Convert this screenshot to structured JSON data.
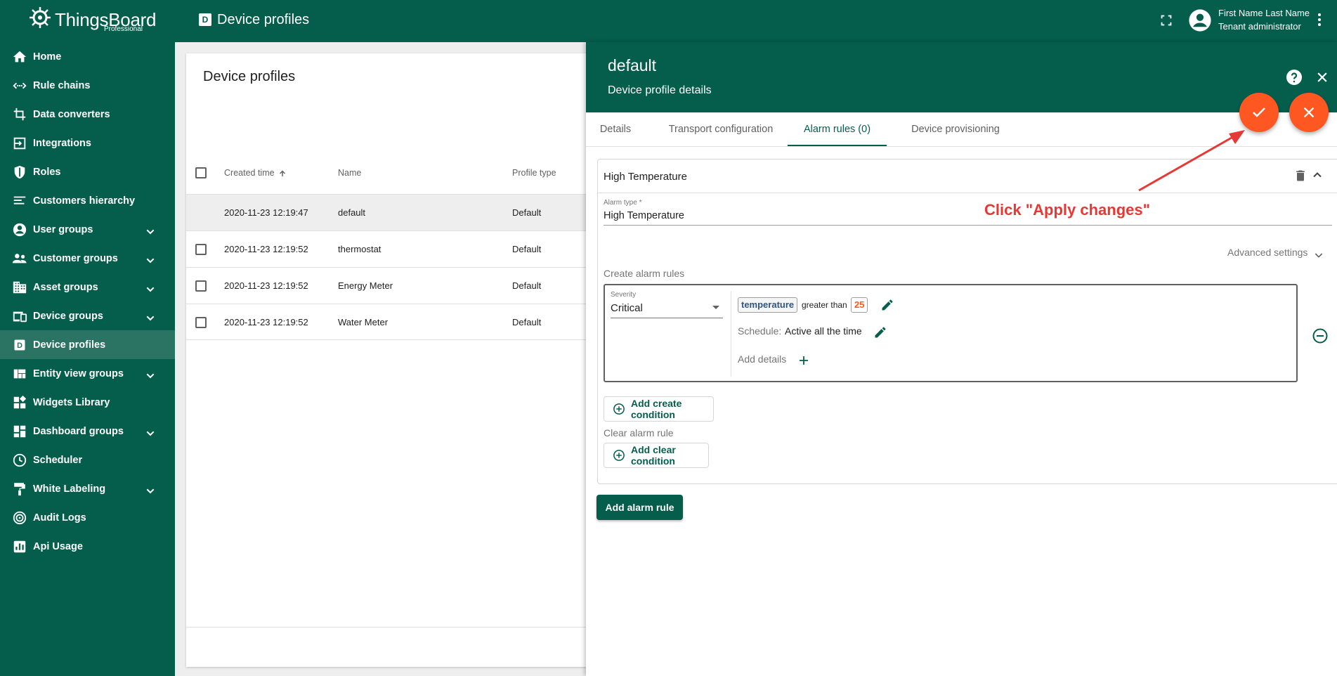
{
  "brand": {
    "name": "ThingsBoard",
    "edition": "Professional"
  },
  "sidebar": {
    "items": [
      {
        "label": "Home",
        "icon": "home-icon"
      },
      {
        "label": "Rule chains",
        "icon": "rule-chain-icon"
      },
      {
        "label": "Data converters",
        "icon": "converter-icon"
      },
      {
        "label": "Integrations",
        "icon": "integration-icon"
      },
      {
        "label": "Roles",
        "icon": "shield-icon"
      },
      {
        "label": "Customers hierarchy",
        "icon": "hierarchy-icon"
      },
      {
        "label": "User groups",
        "icon": "account-circle-icon",
        "expandable": true
      },
      {
        "label": "Customer groups",
        "icon": "people-icon",
        "expandable": true
      },
      {
        "label": "Asset groups",
        "icon": "domain-icon",
        "expandable": true
      },
      {
        "label": "Device groups",
        "icon": "devices-icon",
        "expandable": true
      },
      {
        "label": "Device profiles",
        "icon": "device-profile-icon",
        "active": true
      },
      {
        "label": "Entity view groups",
        "icon": "view-quilt-icon",
        "expandable": true
      },
      {
        "label": "Widgets Library",
        "icon": "widgets-icon"
      },
      {
        "label": "Dashboard groups",
        "icon": "dashboard-icon",
        "expandable": true
      },
      {
        "label": "Scheduler",
        "icon": "clock-icon"
      },
      {
        "label": "White Labeling",
        "icon": "paint-roller-icon",
        "expandable": true
      },
      {
        "label": "Audit Logs",
        "icon": "audit-icon"
      },
      {
        "label": "Api Usage",
        "icon": "chart-icon"
      }
    ]
  },
  "header": {
    "page_icon_letter": "D",
    "title": "Device profiles",
    "user_name": "First Name Last Name",
    "user_role": "Tenant administrator"
  },
  "list": {
    "title": "Device profiles",
    "columns": [
      "Created time",
      "Name",
      "Profile type"
    ],
    "rows": [
      {
        "created": "2020-11-23 12:19:47",
        "name": "default",
        "type": "Default",
        "selected": true
      },
      {
        "created": "2020-11-23 12:19:52",
        "name": "thermostat",
        "type": "Default"
      },
      {
        "created": "2020-11-23 12:19:52",
        "name": "Energy Meter",
        "type": "Default"
      },
      {
        "created": "2020-11-23 12:19:52",
        "name": "Water Meter",
        "type": "Default"
      }
    ]
  },
  "details": {
    "title": "default",
    "subtitle": "Device profile details",
    "tabs": [
      "Details",
      "Transport configuration",
      "Alarm rules (0)",
      "Device provisioning"
    ],
    "active_tab": "Alarm rules (0)",
    "alarm": {
      "name": "High Temperature",
      "type_label": "Alarm type *",
      "type_value": "High Temperature",
      "advanced": "Advanced settings",
      "create_label": "Create alarm rules",
      "severity_label": "Severity",
      "severity_value": "Critical",
      "condition_key": "temperature",
      "condition_op": "greater than",
      "condition_value": "25",
      "schedule_label": "Schedule:",
      "schedule_value": "Active all the time",
      "add_details": "Add details",
      "add_create_condition": "Add create condition",
      "clear_label": "Clear alarm rule",
      "add_clear_condition": "Add clear condition"
    },
    "add_alarm_rule": "Add alarm rule"
  },
  "annotation": {
    "text": "Click \"Apply changes\"",
    "color": "#e53935"
  },
  "colors": {
    "primary": "#055e4c",
    "accent": "#ff5722",
    "active_nav": "#2b7363"
  }
}
